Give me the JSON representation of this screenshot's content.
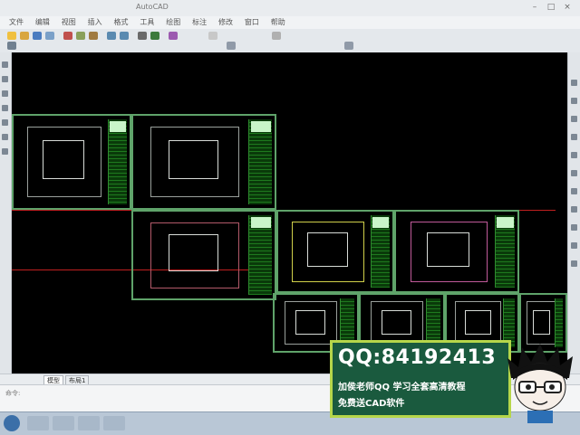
{
  "app": {
    "title": "AutoCAD",
    "window_controls": [
      "–",
      "□",
      "×"
    ]
  },
  "menu": [
    "文件",
    "编辑",
    "视图",
    "插入",
    "格式",
    "工具",
    "绘图",
    "标注",
    "修改",
    "窗口",
    "帮助"
  ],
  "tabs": [
    "模型",
    "布局1"
  ],
  "command": {
    "prompt": "命令:"
  },
  "advert": {
    "qq": "QQ:84192413",
    "line1": "加侯老师QQ 学习全套高清教程",
    "line2": "免费送CAD软件"
  },
  "colors": {
    "canvas": "#000000",
    "sheet_border": "#5fa36a",
    "ad_bg": "#1a5a3e",
    "ad_border": "#b6d64a",
    "redline": "#c02020"
  },
  "icons": [
    "minimize-icon",
    "maximize-icon",
    "close-icon",
    "start-orb-icon"
  ]
}
